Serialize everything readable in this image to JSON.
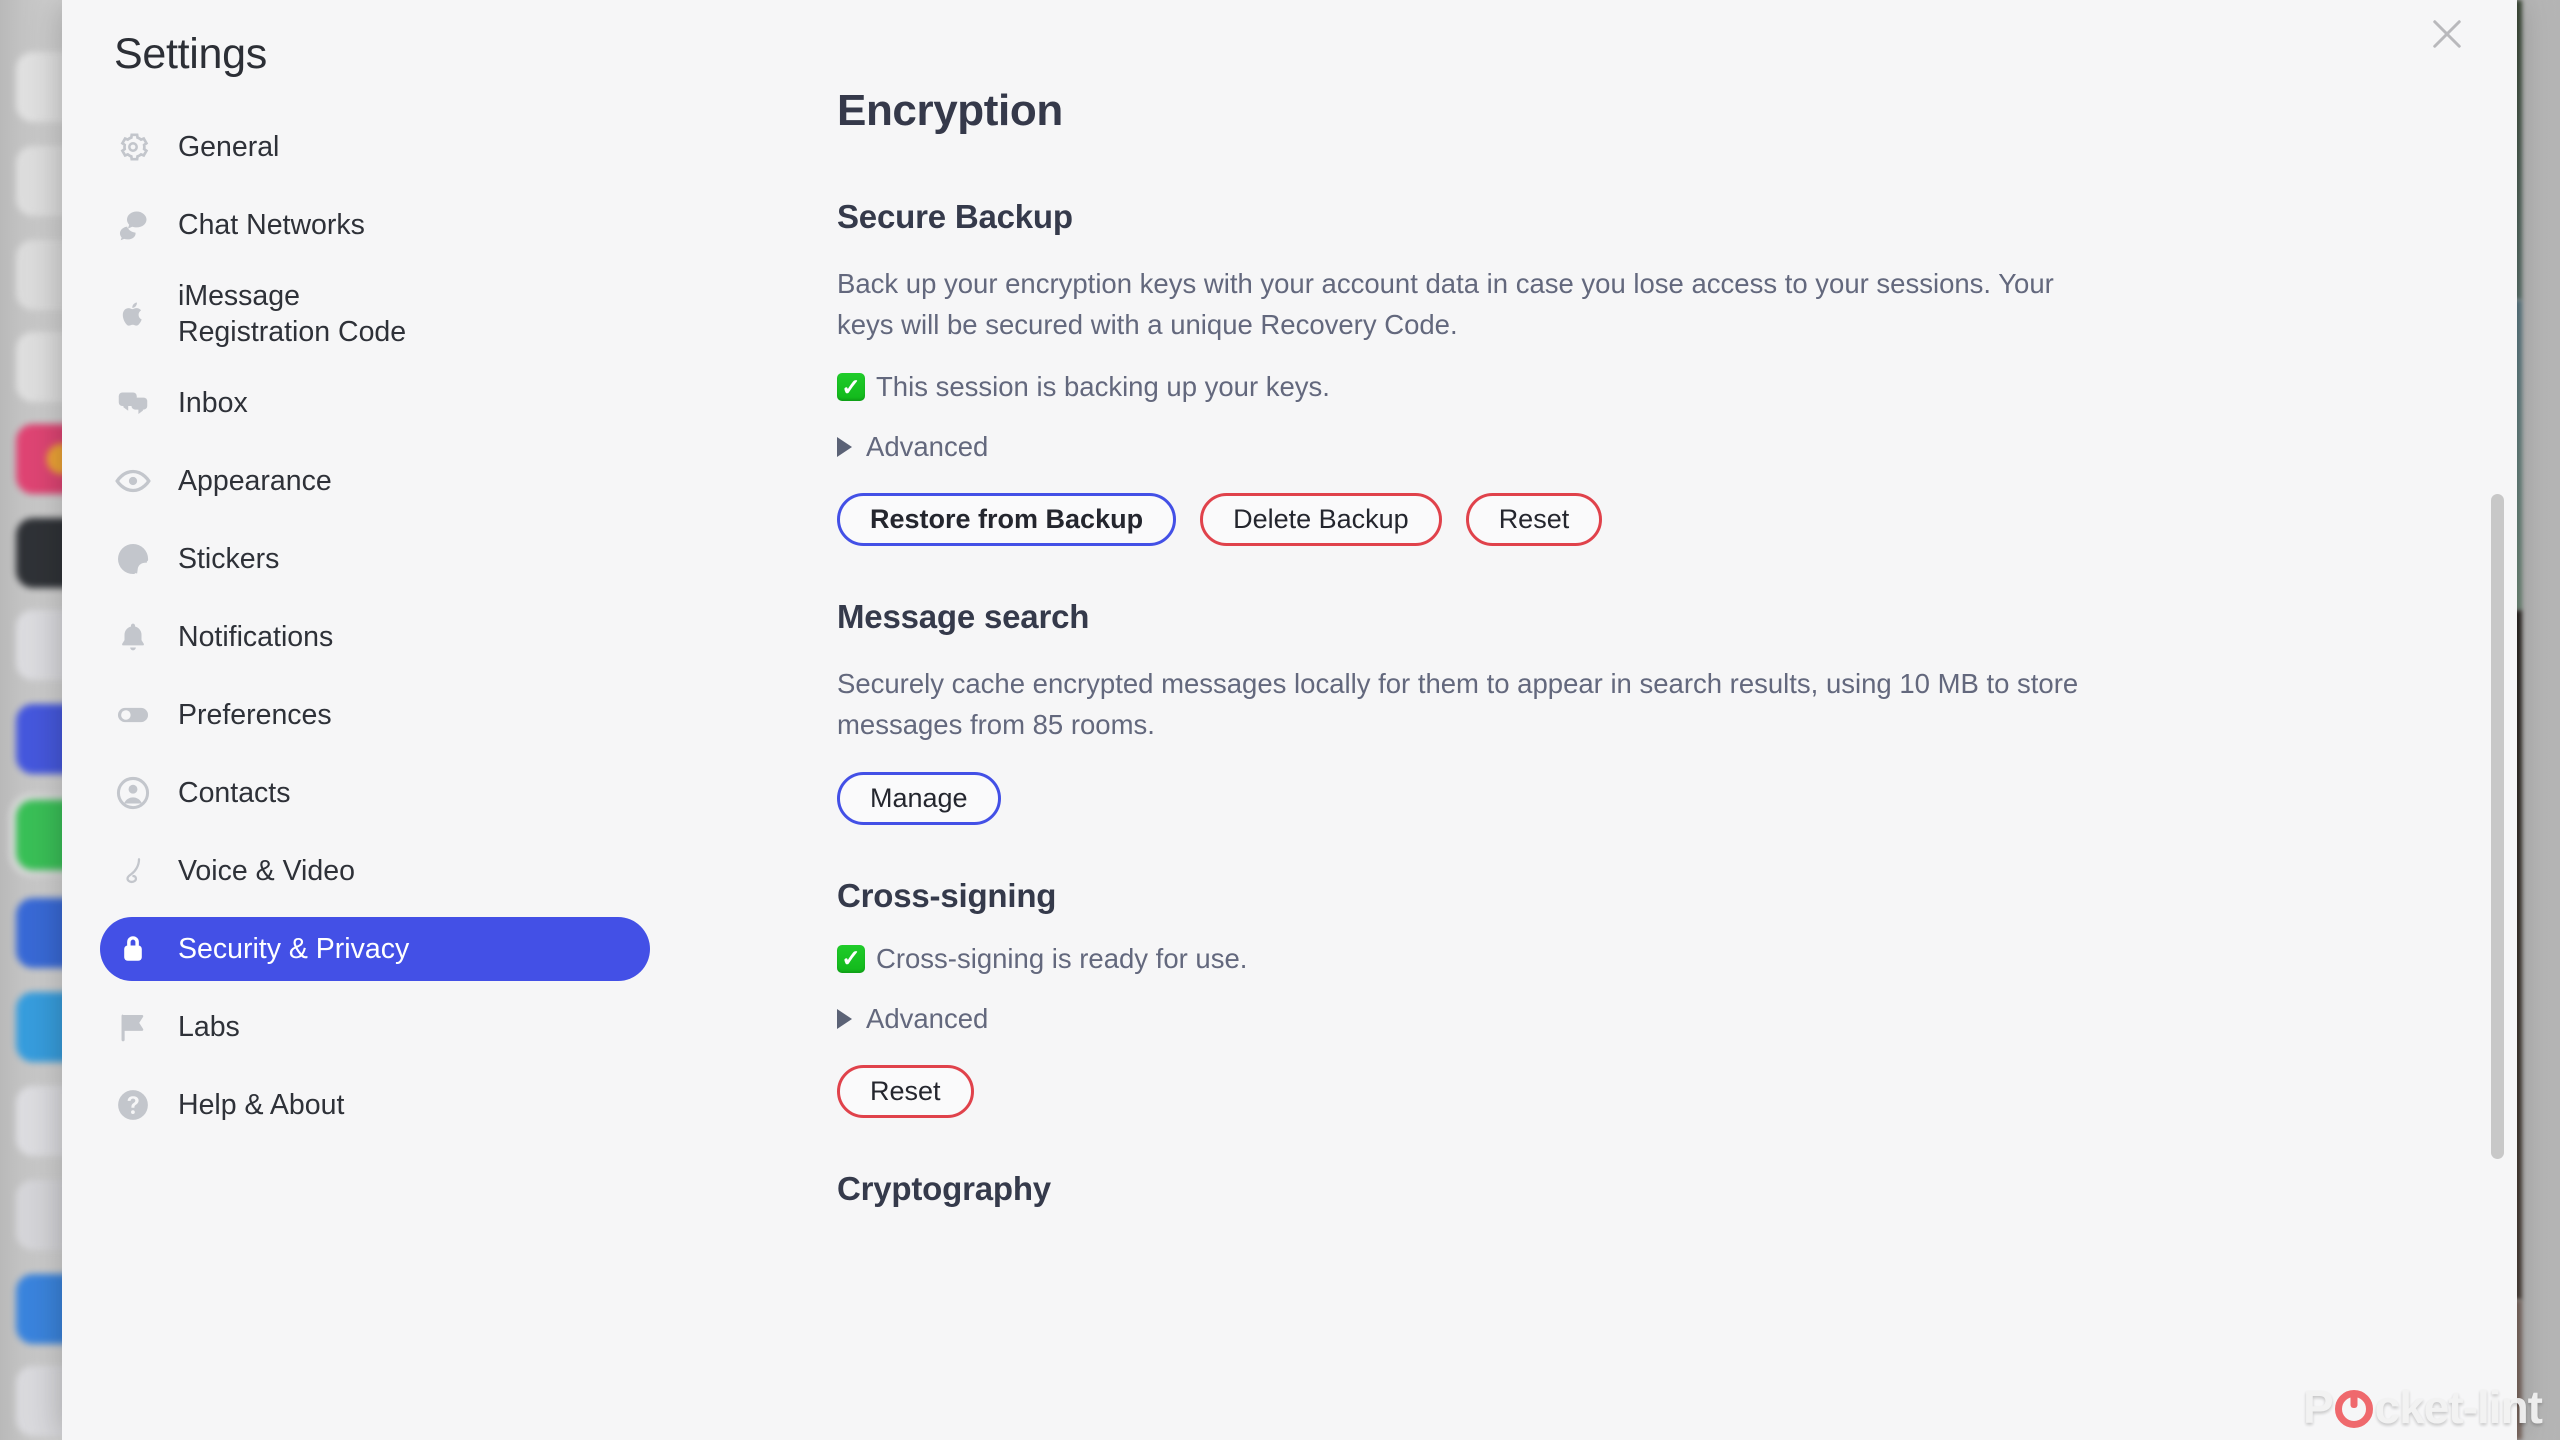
{
  "window": {
    "title": "Settings",
    "close_icon": "close-icon"
  },
  "sidebar": {
    "items": [
      {
        "label": "General",
        "icon": "gear-icon",
        "active": false
      },
      {
        "label": "Chat Networks",
        "icon": "chat-bubbles-icon",
        "active": false
      },
      {
        "label": "iMessage\nRegistration Code",
        "icon": "apple-icon",
        "active": false
      },
      {
        "label": "Inbox",
        "icon": "inbox-icon",
        "active": false
      },
      {
        "label": "Appearance",
        "icon": "eye-icon",
        "active": false
      },
      {
        "label": "Stickers",
        "icon": "sticker-icon",
        "active": false
      },
      {
        "label": "Notifications",
        "icon": "bell-icon",
        "active": false
      },
      {
        "label": "Preferences",
        "icon": "toggle-icon",
        "active": false
      },
      {
        "label": "Contacts",
        "icon": "person-circle-icon",
        "active": false
      },
      {
        "label": "Voice & Video",
        "icon": "phone-icon",
        "active": false
      },
      {
        "label": "Security & Privacy",
        "icon": "lock-icon",
        "active": true
      },
      {
        "label": "Labs",
        "icon": "flag-icon",
        "active": false
      },
      {
        "label": "Help & About",
        "icon": "question-circle-icon",
        "active": false
      }
    ]
  },
  "content": {
    "page_title": "Encryption",
    "secure_backup": {
      "title": "Secure Backup",
      "description": "Back up your encryption keys with your account data in case you lose access to your sessions. Your keys will be secured with a unique Recovery Code.",
      "status": "This session is backing up your keys.",
      "status_icon": "green-check-icon",
      "advanced_label": "Advanced",
      "buttons": [
        {
          "label": "Restore from Backup",
          "style": "primary"
        },
        {
          "label": "Delete Backup",
          "style": "danger"
        },
        {
          "label": "Reset",
          "style": "danger"
        }
      ]
    },
    "message_search": {
      "title": "Message search",
      "description": "Securely cache encrypted messages locally for them to appear in search results, using 10 MB to store messages from 85 rooms.",
      "buttons": [
        {
          "label": "Manage",
          "style": "secondary"
        }
      ]
    },
    "cross_signing": {
      "title": "Cross-signing",
      "status": "Cross-signing is ready for use.",
      "status_icon": "green-check-icon",
      "advanced_label": "Advanced",
      "buttons": [
        {
          "label": "Reset",
          "style": "danger"
        }
      ]
    },
    "cryptography": {
      "title": "Cryptography"
    }
  },
  "watermark": {
    "prefix": "P",
    "suffix": "cket-lint"
  },
  "colors": {
    "accent": "#4350e6",
    "danger": "#e0424b",
    "success": "#14bd1d",
    "panel_bg": "#f6f6f7",
    "heading": "#35394a",
    "body_text": "#63687d"
  }
}
